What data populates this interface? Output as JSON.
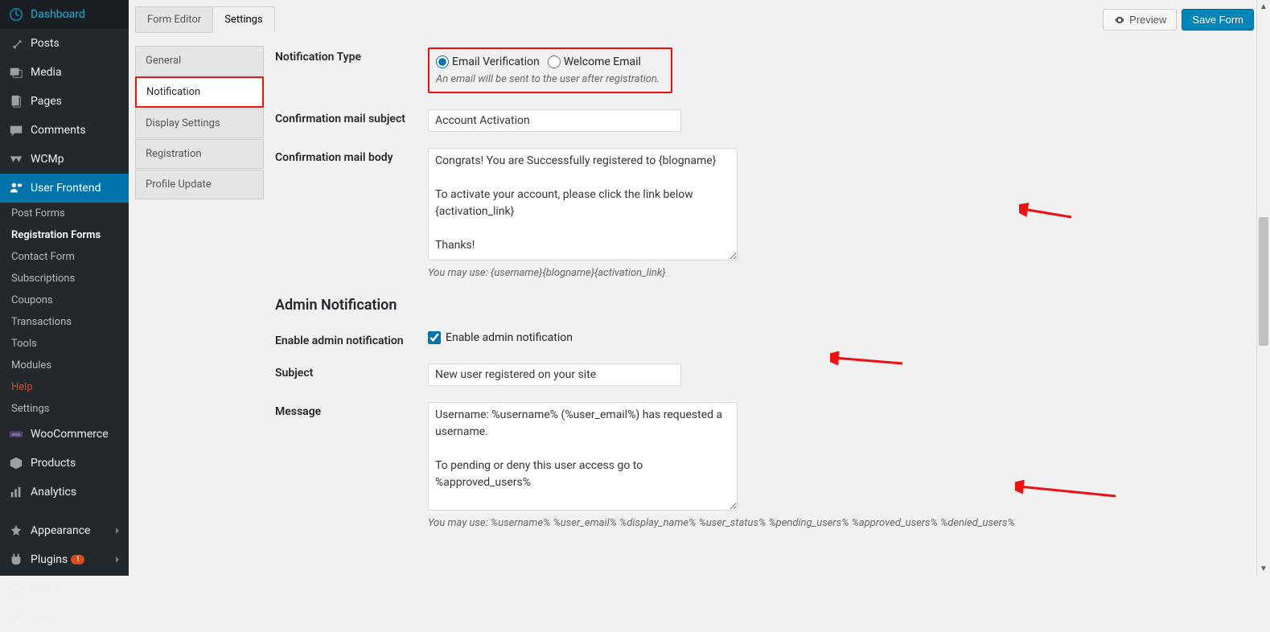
{
  "sidebar": {
    "items": [
      {
        "label": "Dashboard",
        "icon": "dashboard"
      },
      {
        "label": "Posts",
        "icon": "pin"
      },
      {
        "label": "Media",
        "icon": "media"
      },
      {
        "label": "Pages",
        "icon": "pages"
      },
      {
        "label": "Comments",
        "icon": "comments"
      },
      {
        "label": "WCMp",
        "icon": "wcmp"
      },
      {
        "label": "User Frontend",
        "icon": "userfrontend"
      }
    ],
    "sub_items": [
      {
        "label": "Post Forms"
      },
      {
        "label": "Registration Forms"
      },
      {
        "label": "Contact Form"
      },
      {
        "label": "Subscriptions"
      },
      {
        "label": "Coupons"
      },
      {
        "label": "Transactions"
      },
      {
        "label": "Tools"
      },
      {
        "label": "Modules"
      },
      {
        "label": "Help"
      },
      {
        "label": "Settings"
      }
    ],
    "bottom_items": [
      {
        "label": "WooCommerce",
        "icon": "woo"
      },
      {
        "label": "Products",
        "icon": "products"
      },
      {
        "label": "Analytics",
        "icon": "analytics"
      },
      {
        "label": "Appearance",
        "icon": "appearance"
      },
      {
        "label": "Plugins",
        "icon": "plugins",
        "badge": "1"
      },
      {
        "label": "Users",
        "icon": "users"
      },
      {
        "label": "Tools",
        "icon": "tools"
      }
    ]
  },
  "tabs": [
    {
      "label": "Form Editor"
    },
    {
      "label": "Settings"
    }
  ],
  "actions": {
    "preview": "Preview",
    "save": "Save Form"
  },
  "settings_nav": [
    {
      "label": "General"
    },
    {
      "label": "Notification"
    },
    {
      "label": "Display Settings"
    },
    {
      "label": "Registration"
    },
    {
      "label": "Profile Update"
    }
  ],
  "form": {
    "notification_type_label": "Notification Type",
    "notification_type_help": "An email will be sent to the user after registration.",
    "radio_email_verification": "Email Verification",
    "radio_welcome_email": "Welcome Email",
    "confirmation_subject_label": "Confirmation mail subject",
    "confirmation_subject_value": "Account Activation",
    "confirmation_body_label": "Confirmation mail body",
    "confirmation_body_value": "Congrats! You are Successfully registered to {blogname}\n\nTo activate your account, please click the link below\n{activation_link}\n\nThanks!",
    "confirmation_body_hint": "You may use: {username}{blogname}{activation_link}",
    "admin_section_title": "Admin Notification",
    "enable_admin_label": "Enable admin notification",
    "enable_admin_checkbox": "Enable admin notification",
    "subject_label": "Subject",
    "subject_value": "New user registered on your site",
    "message_label": "Message",
    "message_value": "Username: %username% (%user_email%) has requested a username.\n\nTo pending or deny this user access go to %approved_users%\n\nThanks",
    "message_hint": "You may use: %username% %user_email% %display_name% %user_status% %pending_users% %approved_users% %denied_users%"
  }
}
